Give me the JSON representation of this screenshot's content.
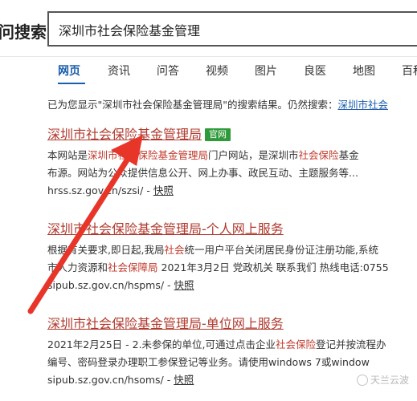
{
  "header": {
    "logo_text": "问搜索",
    "search_value": "深圳市社会保险基金管理"
  },
  "tabs": [
    "网页",
    "资讯",
    "问答",
    "视频",
    "图片",
    "良医",
    "地图",
    "百科"
  ],
  "notice": {
    "prefix": "已为您显示\"深圳市社会保险基金管理局\"的搜索结果。仍然搜索：",
    "link": "深圳市社会"
  },
  "results": [
    {
      "title": "深圳市社会保险基金管理局",
      "badge": "官网",
      "desc_line1": "本网站是深圳市社会保险基金管理局门户网站，是深圳市社会保险基金",
      "desc_line2": "布源。网站为公众提供信息公开、网上办事、政民互动、主题服务等...",
      "url": "hrss.sz.gov.cn/szsi/",
      "cache": "快照"
    },
    {
      "title": "深圳市社会保险基金管理局-个人网上服务",
      "desc_line1": "根据有关要求,即日起,我局社会统一用户平台关闭居民身份证注册功能,系统",
      "desc_line2": "市人力资源和社会保障局 2021年3月2日 党政机关 联系我们 热线电话:0755",
      "url": "sipub.sz.gov.cn/hspms/",
      "cache": "快照"
    },
    {
      "title": "深圳市社会保险基金管理局-单位网上服务",
      "desc_line1": "2021年2月25日 - 2.未参保的单位,可通过点击企业社会保险登记并按流程办",
      "desc_line2": "编号、密码登录办理职工参保登记等业务。请使用windows 7或window",
      "url": "sipub.sz.gov.cn/hsoms/",
      "cache": "快照"
    }
  ],
  "watermark": "天兰云波",
  "colors": {
    "accent_blue": "#1a5dac",
    "title_red": "#b03a2e",
    "badge_green": "#2f9a3a",
    "arrow_red": "#e8352a"
  },
  "url_sep": " - "
}
